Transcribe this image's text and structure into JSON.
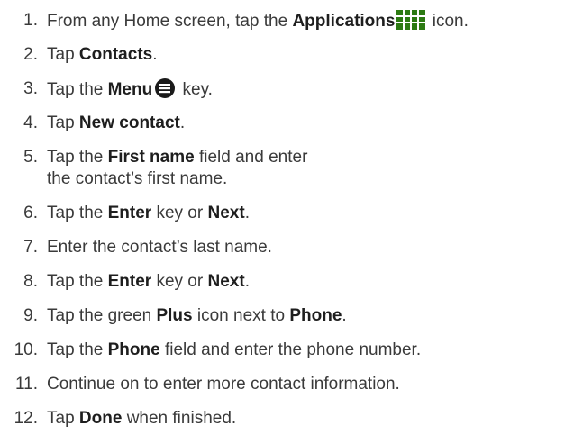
{
  "steps": [
    {
      "num": "1.",
      "parts": [
        "From any Home screen, tap the ",
        "Applications",
        " icon."
      ]
    },
    {
      "num": "2.",
      "parts": [
        "Tap ",
        "Contacts",
        "."
      ]
    },
    {
      "num": "3.",
      "parts": [
        "Tap the ",
        "Menu",
        " key."
      ]
    },
    {
      "num": "4.",
      "parts": [
        "Tap ",
        "New contact",
        "."
      ]
    },
    {
      "num": "5.",
      "parts": [
        "Tap the ",
        "First name",
        " field and enter"
      ],
      "line2": "the contact’s first name."
    },
    {
      "num": "6.",
      "parts": [
        "Tap the ",
        "Enter",
        " key or ",
        "Next",
        "."
      ]
    },
    {
      "num": "7.",
      "parts": [
        "Enter the contact’s last name."
      ]
    },
    {
      "num": "8.",
      "parts": [
        "Tap the ",
        "Enter",
        " key or ",
        "Next",
        "."
      ]
    },
    {
      "num": "9.",
      "parts": [
        "Tap the green ",
        "Plus",
        " icon next to ",
        "Phone",
        "."
      ]
    },
    {
      "num": "10.",
      "parts": [
        "Tap the ",
        "Phone",
        " field and enter the phone number."
      ]
    },
    {
      "num": "11.",
      "parts": [
        "Continue on to enter more contact information."
      ]
    },
    {
      "num": "12.",
      "parts": [
        "Tap ",
        "Done",
        " when finished."
      ]
    }
  ],
  "icons": {
    "applications": "applications-grid-icon",
    "menu": "menu-key-icon"
  },
  "colors": {
    "text": "#3a3a3a",
    "bold": "#1e1e1e",
    "grid_icon": "#2c7a12"
  }
}
